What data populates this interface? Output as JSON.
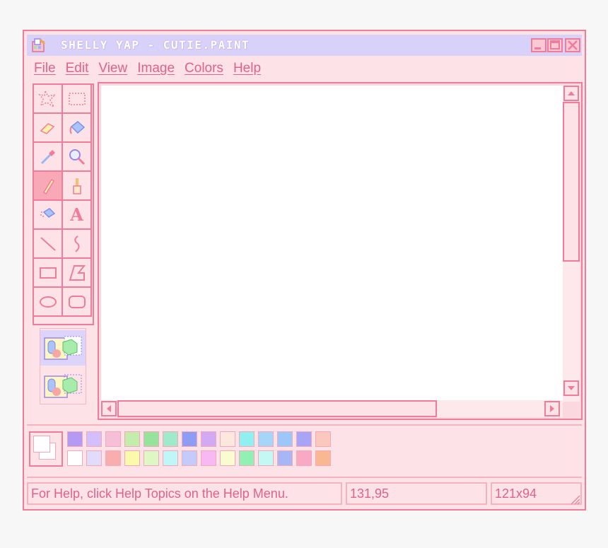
{
  "window": {
    "title": "SHELLY YAP - CUTIE.PAINT",
    "controls": [
      "minimize",
      "maximize",
      "close"
    ]
  },
  "menu": [
    {
      "label": "File"
    },
    {
      "label": "Edit"
    },
    {
      "label": "View"
    },
    {
      "label": "Image"
    },
    {
      "label": "Colors"
    },
    {
      "label": "Help"
    }
  ],
  "tools": [
    {
      "name": "free-select-icon"
    },
    {
      "name": "rect-select-icon"
    },
    {
      "name": "eraser-icon"
    },
    {
      "name": "fill-bucket-icon"
    },
    {
      "name": "color-picker-icon"
    },
    {
      "name": "magnifier-icon"
    },
    {
      "name": "pencil-icon",
      "active": true
    },
    {
      "name": "brush-icon"
    },
    {
      "name": "airbrush-icon"
    },
    {
      "name": "text-icon"
    },
    {
      "name": "line-icon"
    },
    {
      "name": "curve-icon"
    },
    {
      "name": "rectangle-icon"
    },
    {
      "name": "polygon-icon"
    },
    {
      "name": "ellipse-icon"
    },
    {
      "name": "rounded-rect-icon"
    }
  ],
  "text_tool_glyph": "A",
  "tool_options": [
    "opaque-selection-icon",
    "transparent-selection-icon"
  ],
  "palette": {
    "row1": [
      "#b49af4",
      "#d3bff9",
      "#f6bfd8",
      "#c3edaa",
      "#96e39c",
      "#9eeacb",
      "#8f9cf4",
      "#d2a9f4",
      "#fde8e0",
      "#8ff0f0",
      "#a5d5f8",
      "#9cc7fa",
      "#a9a5f6",
      "#fac8bc"
    ],
    "row2": [
      "#ffffff",
      "#e2dcfb",
      "#f9aeae",
      "#fbfaaa",
      "#dff7c4",
      "#c0f6f8",
      "#c5cbf9",
      "#f7b8f3",
      "#fbfbd2",
      "#92f0b4",
      "#c4f8f4",
      "#a8b6f8",
      "#f9a9c3",
      "#f9b892"
    ],
    "foreground": "#ffffff",
    "background": "#ffffff"
  },
  "status": {
    "help": "For Help, click Help Topics on the Help Menu.",
    "coords": "131,95",
    "size": "121x94"
  },
  "colors": {
    "accent": "#f07c99",
    "text": "#e0628a",
    "window_bg": "#fde3e8",
    "titlebar": "#d8d2fb"
  }
}
